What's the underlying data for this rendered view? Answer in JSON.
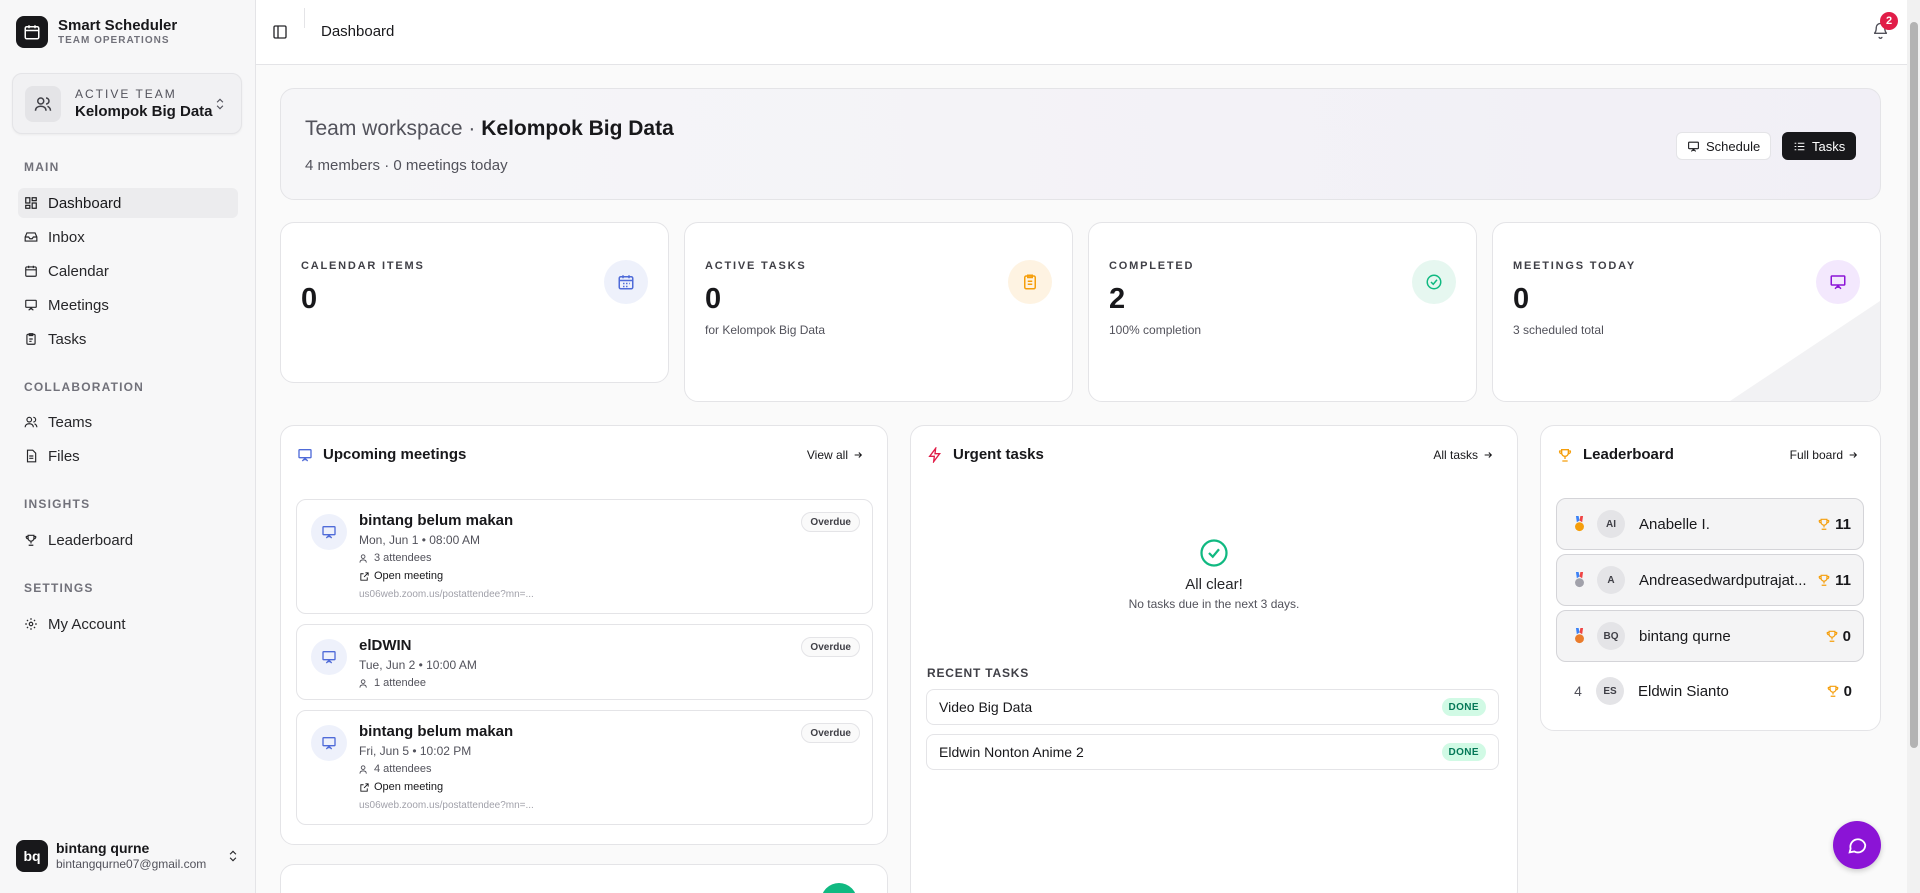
{
  "app": {
    "name": "Smart Scheduler",
    "subtitle": "TEAM OPERATIONS"
  },
  "team_switcher": {
    "label": "ACTIVE TEAM",
    "team_name": "Kelompok Big Data"
  },
  "sidebar": {
    "sections": [
      {
        "title": "MAIN",
        "items": [
          {
            "label": "Dashboard",
            "icon": "dashboard-icon",
            "active": true
          },
          {
            "label": "Inbox",
            "icon": "inbox-icon"
          },
          {
            "label": "Calendar",
            "icon": "calendar-icon"
          },
          {
            "label": "Meetings",
            "icon": "meetings-icon"
          },
          {
            "label": "Tasks",
            "icon": "tasks-icon"
          }
        ]
      },
      {
        "title": "COLLABORATION",
        "items": [
          {
            "label": "Teams",
            "icon": "users-icon"
          },
          {
            "label": "Files",
            "icon": "file-icon"
          }
        ]
      },
      {
        "title": "INSIGHTS",
        "items": [
          {
            "label": "Leaderboard",
            "icon": "trophy-icon"
          }
        ]
      },
      {
        "title": "SETTINGS",
        "items": [
          {
            "label": "My Account",
            "icon": "gear-icon"
          }
        ]
      }
    ]
  },
  "user": {
    "initials": "bq",
    "name": "bintang qurne",
    "email": "bintangqurne07@gmail.com"
  },
  "header": {
    "breadcrumb": "Dashboard",
    "notification_count": "2"
  },
  "hero": {
    "prefix": "Team workspace · ",
    "team_name": "Kelompok Big Data",
    "subtitle": "4 members · 0 meetings today",
    "schedule_button": "Schedule",
    "tasks_button": "Tasks"
  },
  "stats": [
    {
      "label": "CALENDAR ITEMS",
      "value": "0",
      "sub": "",
      "icon": "calendar-icon",
      "color": "#4f6bd8",
      "bg": "#eef1fb"
    },
    {
      "label": "ACTIVE TASKS",
      "value": "0",
      "sub": "for Kelompok Big Data",
      "icon": "clipboard-icon",
      "color": "#f59e0b",
      "bg": "#fef3e2"
    },
    {
      "label": "COMPLETED",
      "value": "2",
      "sub": "100% completion",
      "icon": "check-circle-icon",
      "color": "#10b981",
      "bg": "#e6f7f0"
    },
    {
      "label": "MEETINGS TODAY",
      "value": "0",
      "sub": "3 scheduled total",
      "icon": "presentation-icon",
      "color": "#8b14d6",
      "bg": "#f3e8fd"
    }
  ],
  "upcoming": {
    "title": "Upcoming meetings",
    "link": "View all",
    "items": [
      {
        "title": "bintang belum makan",
        "time": "Mon, Jun 1 • 08:00 AM",
        "attendees": "3 attendees",
        "open": "Open meeting",
        "url": "us06web.zoom.us/postattendee?mn=...",
        "status": "Overdue"
      },
      {
        "title": "elDWIN",
        "time": "Tue, Jun 2 • 10:00 AM",
        "attendees": "1 attendee",
        "status": "Overdue"
      },
      {
        "title": "bintang belum makan",
        "time": "Fri, Jun 5 • 10:02 PM",
        "attendees": "4 attendees",
        "open": "Open meeting",
        "url": "us06web.zoom.us/postattendee?mn=...",
        "status": "Overdue"
      }
    ]
  },
  "urgent": {
    "title": "Urgent tasks",
    "link": "All tasks",
    "empty_title": "All clear!",
    "empty_sub": "No tasks due in the next 3 days.",
    "recent_label": "RECENT TASKS",
    "recent": [
      {
        "name": "Video Big Data",
        "status": "DONE"
      },
      {
        "name": "Eldwin Nonton Anime 2",
        "status": "DONE"
      }
    ]
  },
  "leaderboard": {
    "title": "Leaderboard",
    "link": "Full board",
    "rows": [
      {
        "rank": "1",
        "medal": "gold",
        "initials": "AI",
        "name": "Anabelle I.",
        "score": "11"
      },
      {
        "rank": "2",
        "medal": "silver",
        "initials": "A",
        "name": "Andreasedwardputrajat...",
        "score": "11"
      },
      {
        "rank": "3",
        "medal": "bronze",
        "initials": "BQ",
        "name": "bintang qurne",
        "score": "0"
      },
      {
        "rank": "4",
        "medal": "",
        "initials": "ES",
        "name": "Eldwin Sianto",
        "score": "0"
      }
    ]
  },
  "colors": {
    "accent_purple": "#8b14d6",
    "dark": "#18181b",
    "overdue_border": "#e4e4e7",
    "done_bg": "#d1fae5",
    "done_text": "#047857",
    "badge_red": "#e11d48"
  }
}
